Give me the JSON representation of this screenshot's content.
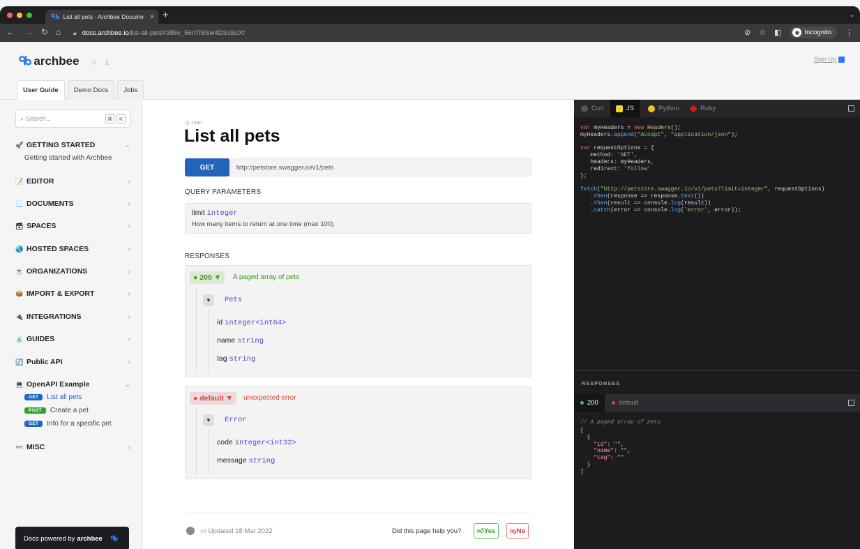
{
  "browser": {
    "tab_title": "List all pets - Archbee Docume",
    "url_host": "docs.archbee.io",
    "url_path": "/list-all-pets#386v_56n7NiSw4DSsBcXf",
    "incognito_label": "Incognito"
  },
  "header": {
    "logo_text": "archbee",
    "signup_label": "Sign Up",
    "tabs": [
      {
        "label": "User Guide"
      },
      {
        "label": "Demo Docs"
      },
      {
        "label": "Jobs"
      }
    ]
  },
  "sidebar": {
    "search_placeholder": "Search...",
    "shortcut_keys": [
      "⌘",
      "K"
    ],
    "sections": [
      {
        "icon": "🚀",
        "label": "GETTING STARTED",
        "expanded": true
      },
      {
        "icon": "📝",
        "label": "EDITOR"
      },
      {
        "icon": "📃",
        "label": "DOCUMENTS"
      },
      {
        "icon": "🗃",
        "label": "SPACES"
      },
      {
        "icon": "🌏",
        "label": "HOSTED SPACES"
      },
      {
        "icon": "☕",
        "label": "ORGANIZATIONS"
      },
      {
        "icon": "📦",
        "label": "IMPORT & EXPORT"
      },
      {
        "icon": "🔌",
        "label": "INTEGRATIONS"
      },
      {
        "icon": "⛲",
        "label": "GUIDES"
      },
      {
        "icon": "🔄",
        "label": "Public API"
      },
      {
        "icon": "💻",
        "label": "OpenAPI Example",
        "expanded": true
      },
      {
        "icon": "👓",
        "label": "MISC"
      }
    ],
    "getting_started_child": "Getting started with Archbee",
    "openapi_children": [
      {
        "method": "GET",
        "label": "List all pets"
      },
      {
        "method": "POST",
        "label": "Create a pet"
      },
      {
        "method": "GET",
        "label": "Info for a specific pet"
      }
    ],
    "powered_prefix": "Docs powered by",
    "powered_brand": "archbee"
  },
  "main": {
    "read_time": "1min",
    "title": "List all pets",
    "method": "GET",
    "url": "http://petstore.swagger.io/v1/pets",
    "query_heading": "QUERY PARAMETERS",
    "query_param": {
      "name": "limit",
      "type": "integer",
      "description": "How many items to return at one time (max 100)"
    },
    "responses_heading": "RESPONSES",
    "responses": [
      {
        "status": "200",
        "description": "A paged array of pets",
        "object": "Pets",
        "fields": [
          {
            "name": "id",
            "type": "integer<int64>"
          },
          {
            "name": "name",
            "type": "string"
          },
          {
            "name": "tag",
            "type": "string"
          }
        ]
      },
      {
        "status": "default",
        "description": "unexpected error",
        "object": "Error",
        "fields": [
          {
            "name": "code",
            "type": "integer<int32>"
          },
          {
            "name": "message",
            "type": "string"
          }
        ]
      }
    ],
    "updated": "Updated 18 Mar 2022",
    "help_question": "Did this page help you?",
    "yes_label": "Yes",
    "no_label": "No"
  },
  "code_panel": {
    "languages": [
      "Curl",
      "JS",
      "Python",
      "Ruby"
    ],
    "active_language": "JS",
    "responses_label": "RESPONSES",
    "response_tabs": [
      "200",
      "default"
    ],
    "active_response": "200",
    "response_comment": "// A paged array of pets"
  },
  "colors": {
    "accent": "#2f7bf5",
    "get_method": "#2164b8",
    "post_method": "#2da42d",
    "success": "#3a9a1f",
    "error": "#e0433c",
    "code_bg": "#1c1c1e"
  }
}
